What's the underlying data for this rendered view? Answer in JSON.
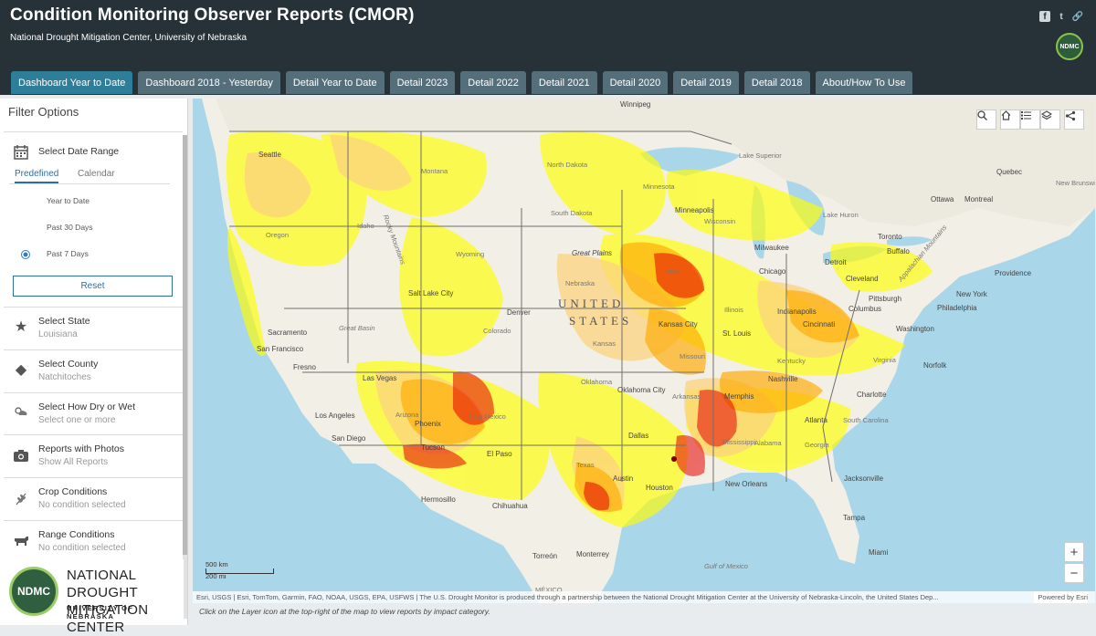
{
  "header": {
    "title": "Condition Monitoring Observer Reports (CMOR)",
    "subtitle": "National Drought Mitigation Center, University of Nebraska",
    "badge": "NDMC"
  },
  "social": [
    "f",
    "t",
    "🔗"
  ],
  "tabs": [
    {
      "label": "Dashboard Year to Date",
      "active": true
    },
    {
      "label": "Dashboard 2018 - Yesterday"
    },
    {
      "label": "Detail Year to Date"
    },
    {
      "label": "Detail 2023"
    },
    {
      "label": "Detail 2022"
    },
    {
      "label": "Detail 2021"
    },
    {
      "label": "Detail 2020"
    },
    {
      "label": "Detail 2019"
    },
    {
      "label": "Detail 2018"
    },
    {
      "label": "About/How To Use"
    }
  ],
  "sidebar": {
    "title": "Filter Options",
    "date_range": {
      "title": "Select Date Range",
      "subtabs": [
        "Predefined",
        "Calendar"
      ],
      "options": [
        "Year to Date",
        "Past 30 Days",
        "Past 7 Days"
      ],
      "selected": "Past 7 Days",
      "reset": "Reset"
    },
    "state": {
      "title": "Select State",
      "value": "Louisiana"
    },
    "county": {
      "title": "Select County",
      "value": "Natchitoches"
    },
    "dryness": {
      "title": "Select How Dry or Wet",
      "value": "Select one or more"
    },
    "photos": {
      "title": "Reports with Photos",
      "value": "Show All Reports"
    },
    "crop": {
      "title": "Crop Conditions",
      "value": "No condition selected"
    },
    "range": {
      "title": "Range Conditions",
      "value": "No condition selected"
    },
    "logo": {
      "badge": "NDMC",
      "line1": "NATIONAL DROUGHT",
      "line2": "MITIGATION CENTER",
      "line3": "UNIVERSITY OF NEBRASKA"
    }
  },
  "map": {
    "labels": {
      "winnipeg": "Winnipeg",
      "seattle": "Seattle",
      "montana": "Montana",
      "north_dakota": "North Dakota",
      "minnesota": "Minnesota",
      "lake_superior": "Lake Superior",
      "south_dakota": "South Dakota",
      "minneapolis": "Minneapolis",
      "wisconsin": "Wisconsin",
      "ottawa": "Ottawa",
      "montreal": "Montreal",
      "quebec": "Quebec",
      "new_brunswick": "New Brunswick",
      "oregon": "Oregon",
      "idaho": "Idaho",
      "wyoming": "Wyoming",
      "great_plains": "Great Plains",
      "lake_huron": "Lake Huron",
      "toronto": "Toronto",
      "milwaukee": "Milwaukee",
      "chicago": "Chicago",
      "detroit": "Detroit",
      "buffalo": "Buffalo",
      "nebraska": "Nebraska",
      "iowa": "Iowa",
      "cleveland": "Cleveland",
      "providence": "Providence",
      "pittsburgh": "Pittsburgh",
      "new_york": "New York",
      "philadelphia": "Philadelphia",
      "salt_lake_city": "Salt Lake City",
      "denver": "Denver",
      "united_states_1": "UNITED",
      "united_states_2": "STATES",
      "kansas_city": "Kansas City",
      "illinois": "Illinois",
      "indianapolis": "Indianapolis",
      "columbus": "Columbus",
      "sacramento": "Sacramento",
      "san_francisco": "San Francisco",
      "great_basin": "Great Basin",
      "colorado": "Colorado",
      "kansas": "Kansas",
      "missouri": "Missouri",
      "st_louis": "St. Louis",
      "cincinnati": "Cincinnati",
      "washington": "Washington",
      "fresno": "Fresno",
      "las_vegas": "Las Vegas",
      "kentucky": "Kentucky",
      "virginia": "Virginia",
      "norfolk": "Norfolk",
      "nashville": "Nashville",
      "oklahoma": "Oklahoma",
      "oklahoma_city": "Oklahoma City",
      "arkansas": "Arkansas",
      "memphis": "Memphis",
      "charlotte": "Charlotte",
      "los_angeles": "Los Angeles",
      "arizona": "Arizona",
      "phoenix": "Phoenix",
      "new_mexico": "New Mexico",
      "atlanta": "Atlanta",
      "south_carolina": "South Carolina",
      "san_diego": "San Diego",
      "tucson": "Tucson",
      "el_paso": "El Paso",
      "dallas": "Dallas",
      "mississippi": "Mississippi",
      "alabama": "Alabama",
      "georgia": "Georgia",
      "texas": "Texas",
      "austin": "Austin",
      "houston": "Houston",
      "new_orleans": "New Orleans",
      "jacksonville": "Jacksonville",
      "hermosillo": "Hermosillo",
      "chihuahua": "Chihuahua",
      "tampa": "Tampa",
      "monterrey": "Monterrey",
      "torreon": "Torreón",
      "miami": "Miami",
      "gulf_of_mexico": "Gulf of Mexico",
      "mexico": "MÉXICO",
      "rocky_mountains": "Rocky Mountains",
      "appalachian": "Appalachian Mountains"
    },
    "scale_km": "500 km",
    "scale_mi": "200 mi",
    "attribution": "Esri, USGS | Esri, TomTom, Garmin, FAO, NOAA, USGS, EPA, USFWS | The U.S. Drought Monitor is produced through a partnership between the National Drought Mitigation Center at the University of Nebraska-Lincoln, the United States Dep...",
    "powered_by": "Powered by Esri",
    "footnote": "Click on the Layer icon at the top-right of the map to view reports by impact category."
  },
  "colors": {
    "header": "#263238",
    "tab": "#546e7a",
    "tab_active": "#2e7d99",
    "d0": "#ffff00",
    "d1": "#fcd37f",
    "d2": "#ffaa00",
    "d3": "#e60000"
  }
}
